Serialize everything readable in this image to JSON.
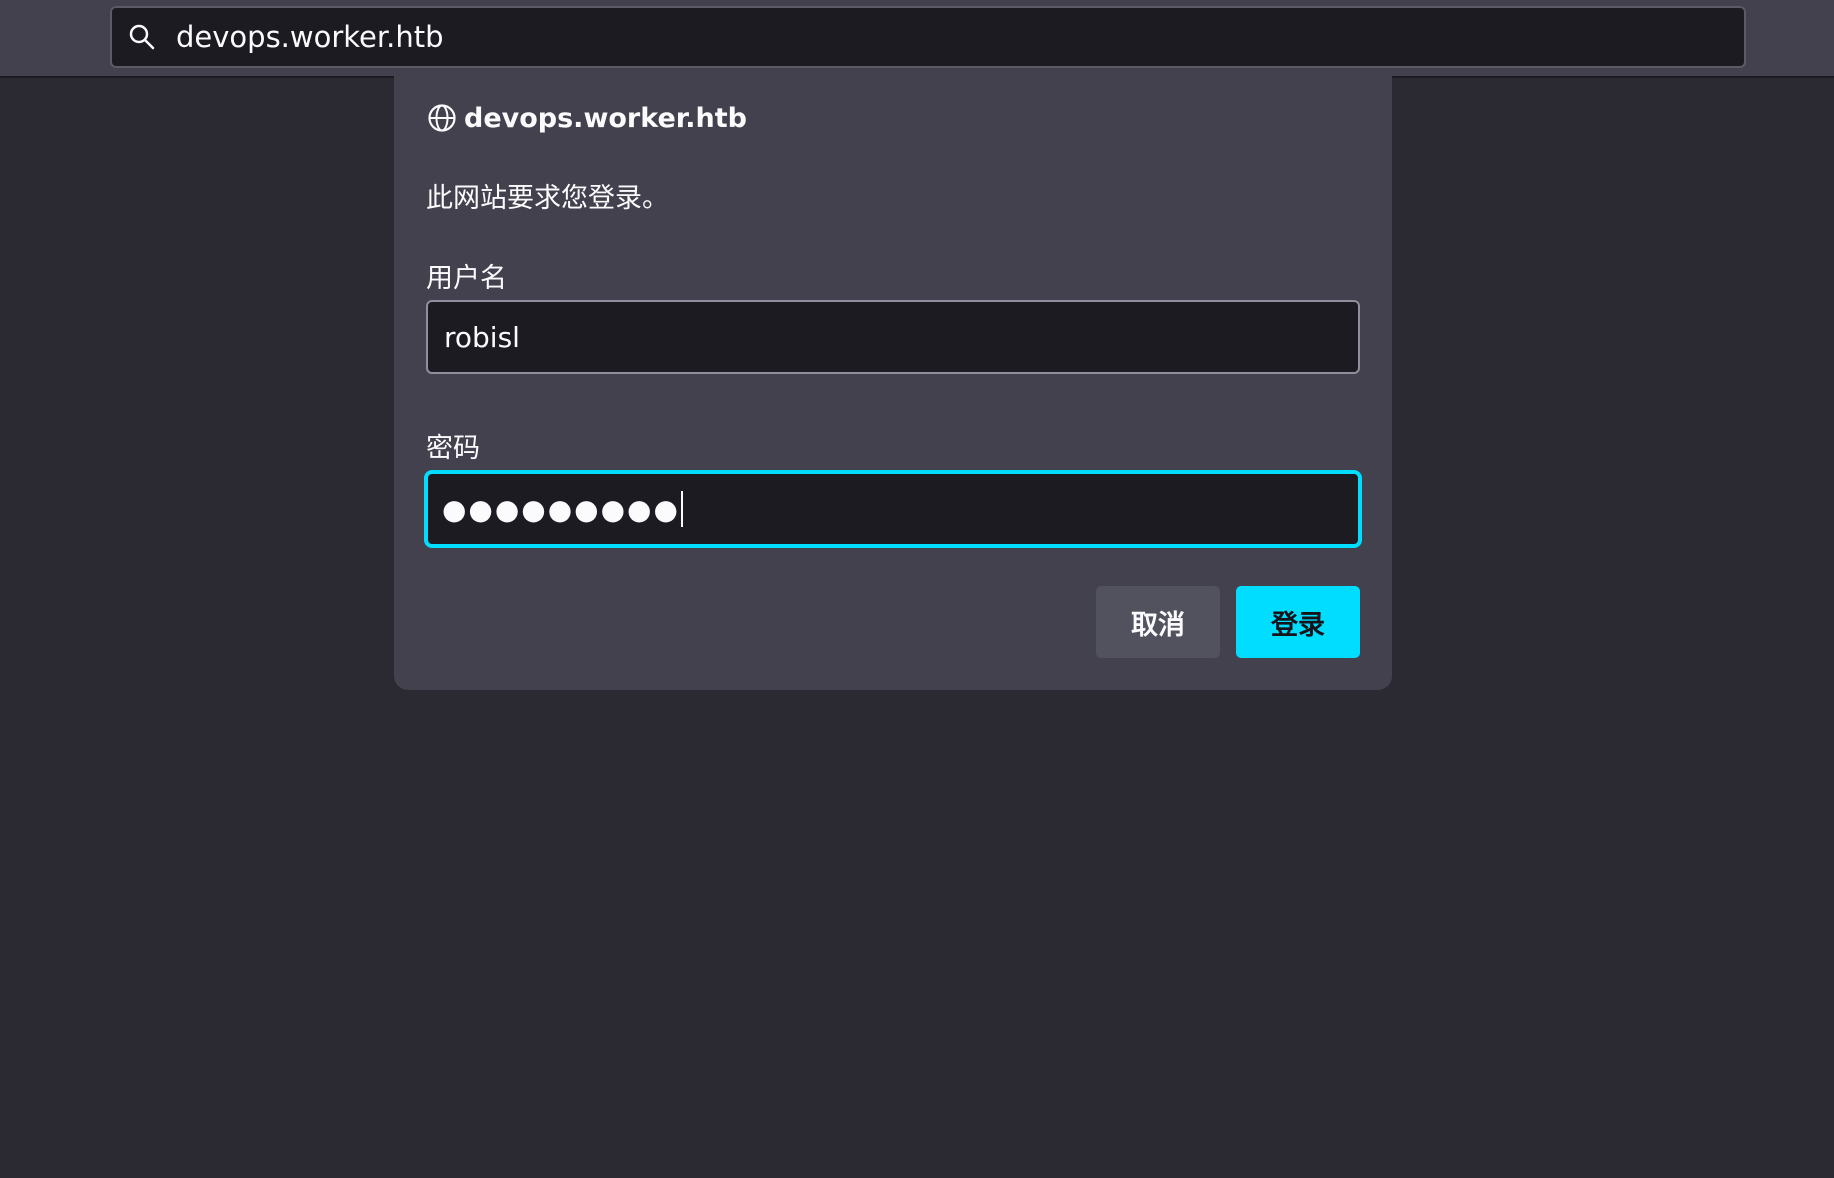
{
  "urlbar": {
    "url": "devops.worker.htb",
    "icon": "search-icon"
  },
  "dialog": {
    "host": "devops.worker.htb",
    "host_icon": "globe-icon",
    "message": "此网站要求您登录。",
    "username_label": "用户名",
    "username_value": "robisl",
    "password_label": "密码",
    "password_mask": "●●●●●●●●●",
    "cancel_label": "取消",
    "login_label": "登录"
  },
  "colors": {
    "accent": "#00ddff",
    "background": "#2b2a33",
    "dialog": "#42414d",
    "input": "#1c1b22"
  }
}
